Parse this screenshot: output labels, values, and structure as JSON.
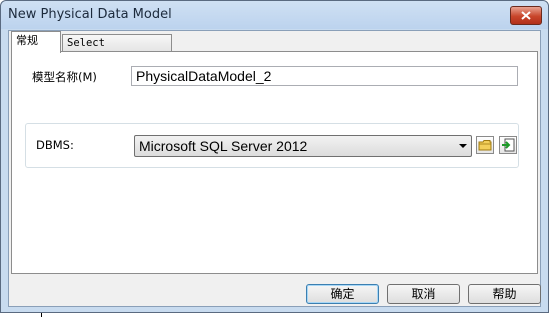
{
  "window": {
    "title": "New Physical Data Model"
  },
  "tabs": [
    {
      "label": "常规",
      "active": true
    },
    {
      "label": "Select Extensions",
      "active": false
    }
  ],
  "general": {
    "model_name_label": "模型名称(M)",
    "model_name_value": "PhysicalDataModel_2",
    "dbms_label": "DBMS:",
    "dbms_selected": "Microsoft SQL Server 2012"
  },
  "buttons": {
    "ok": "确定",
    "cancel": "取消",
    "help": "帮助"
  },
  "icons": {
    "close": "close-icon",
    "browse": "folder-icon",
    "import": "import-icon"
  }
}
